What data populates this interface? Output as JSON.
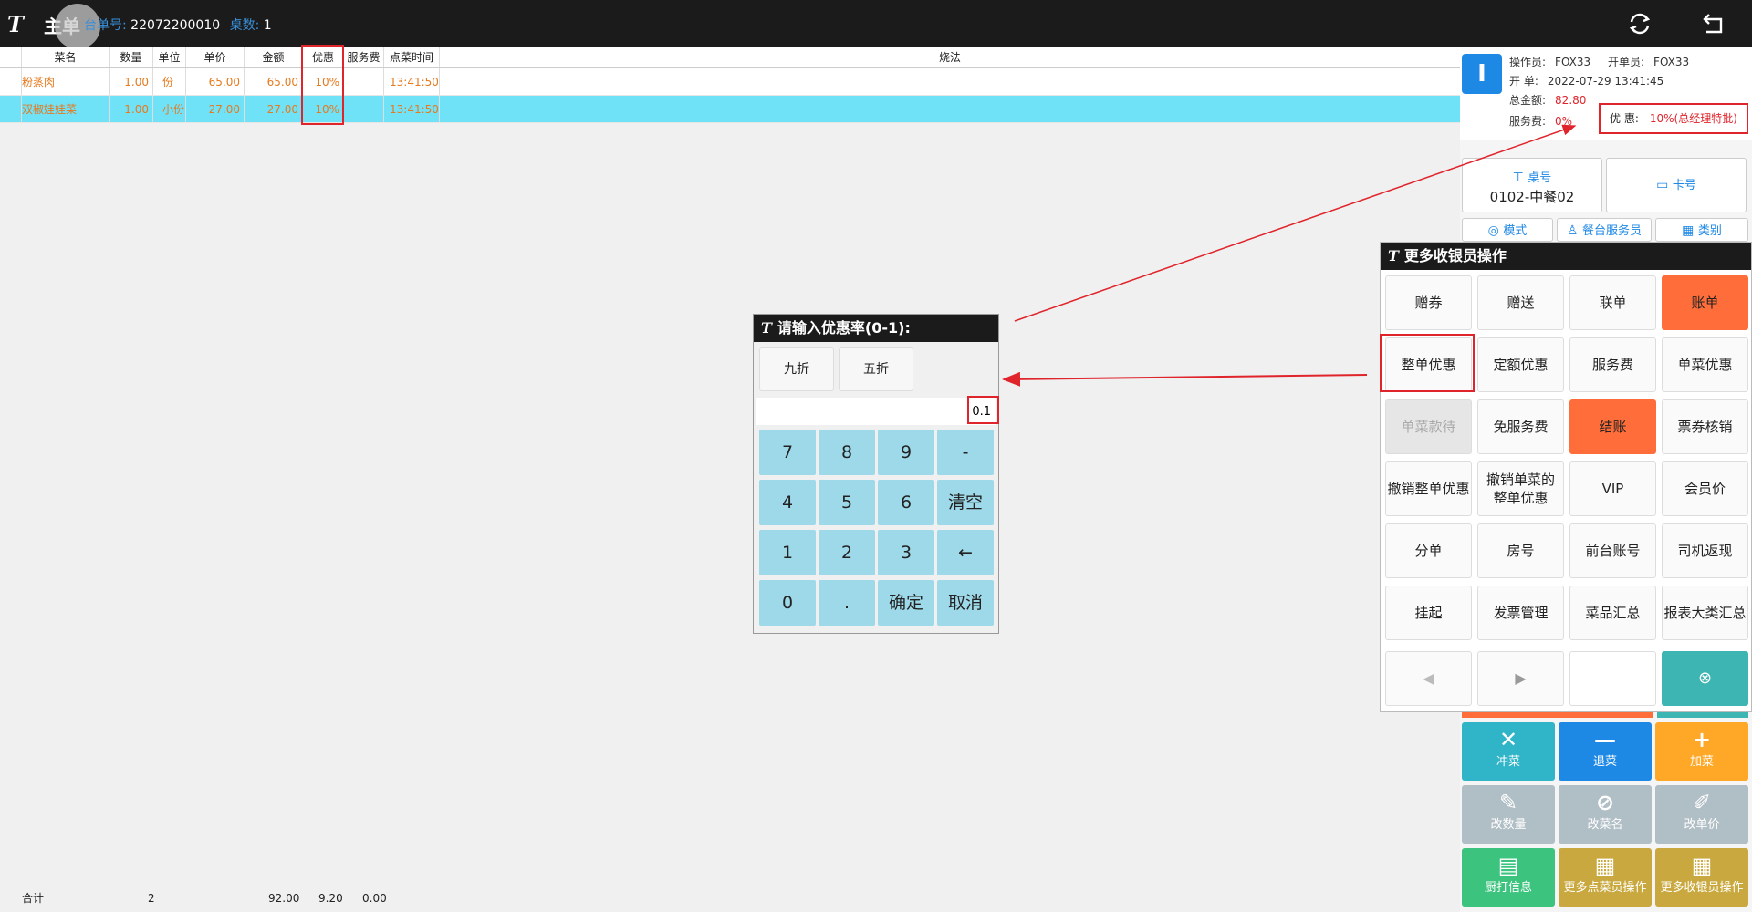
{
  "topbar": {
    "logo": "T",
    "title": "主单",
    "order_no_label": "台单号:",
    "order_no": "22072200010",
    "table_count_label": "桌数:",
    "table_count": "1"
  },
  "table": {
    "headers": [
      "菜名",
      "数量",
      "单位",
      "单价",
      "金额",
      "优惠",
      "服务费",
      "点菜时间",
      "烧法"
    ],
    "rows": [
      {
        "name": "粉蒸肉",
        "qty": "1.00",
        "unit": "份",
        "price": "65.00",
        "amount": "65.00",
        "discount": "10%",
        "service": "",
        "time": "13:41:50",
        "method": ""
      },
      {
        "name": "双椒娃娃菜",
        "qty": "1.00",
        "unit": "小份",
        "price": "27.00",
        "amount": "27.00",
        "discount": "10%",
        "service": "",
        "time": "13:41:50",
        "method": ""
      }
    ]
  },
  "totals": {
    "label": "合计",
    "qty": "2",
    "amount": "92.00",
    "discount": "9.20",
    "service": "0.00"
  },
  "info": {
    "badge": "I",
    "operator_label": "操作员:",
    "operator": "FOX33",
    "opener_label": "开单员:",
    "opener": "FOX33",
    "open_label": "开 单:",
    "open_time": "2022-07-29 13:41:45",
    "total_label": "总金额:",
    "total": "82.80",
    "service_label": "服务费:",
    "service": "0%",
    "discount_label": "优 惠:",
    "discount": "10%(总经理特批)"
  },
  "panel": {
    "table_no_label": "桌号",
    "table_no": "0102-中餐02",
    "card_label": "卡号",
    "mode_label": "模式",
    "waiter_label": "餐台服务员",
    "category_label": "类别"
  },
  "tiles": {
    "cancel_dish": "冲菜",
    "return_dish": "退菜",
    "add_dish": "加菜",
    "change_qty": "改数量",
    "change_name": "改菜名",
    "change_price": "改单价",
    "kitchen_print": "厨打信息",
    "more_order_ops": "更多点菜员操作",
    "more_cashier_ops": "更多收银员操作"
  },
  "ops_popup": {
    "title": "更多收银员操作",
    "buttons": [
      "赠券",
      "赠送",
      "联单",
      "账单",
      "整单优惠",
      "定额优惠",
      "服务费",
      "单菜优惠",
      "单菜款待",
      "免服务费",
      "结账",
      "票券核销",
      "撤销整单优惠",
      "撤销单菜的整单优惠",
      "VIP",
      "会员价",
      "分单",
      "房号",
      "前台账号",
      "司机返现",
      "挂起",
      "发票管理",
      "菜品汇总",
      "报表大类汇总"
    ]
  },
  "discount_dialog": {
    "title": "请输入优惠率(0-1):",
    "preset_1": "九折",
    "preset_2": "五折",
    "input_value": "0.1",
    "keys": [
      "7",
      "8",
      "9",
      "-",
      "4",
      "5",
      "6",
      "清空",
      "1",
      "2",
      "3",
      "←",
      "0",
      ".",
      "确定",
      "取消"
    ]
  },
  "colors": {
    "accent_blue": "#1e88e5",
    "highlight_red": "#e0242b",
    "orange": "#ff6e3a",
    "teal": "#3db5b2",
    "selected_row": "#6fe2f8",
    "key_blue": "#9ed9ea"
  }
}
